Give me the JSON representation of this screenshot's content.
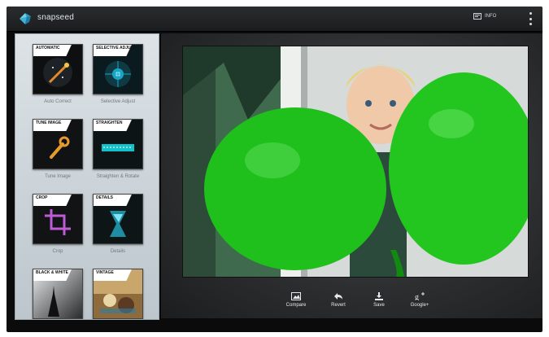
{
  "app": {
    "title": "snapseed",
    "info_label": "INFO"
  },
  "icons": {
    "logo": "snapseed-leaf-icon",
    "info": "info-icon",
    "overflow": "overflow-menu-icon",
    "compare": "compare-icon",
    "revert": "revert-icon",
    "save": "save-icon",
    "share": "google-plus-icon"
  },
  "tools": [
    {
      "tag": "AUTOMATIC",
      "label": "Auto Correct"
    },
    {
      "tag": "SELECTIVE ADJUST",
      "label": "Selective Adjust"
    },
    {
      "tag": "TUNE IMAGE",
      "label": "Tune Image"
    },
    {
      "tag": "STRAIGHTEN",
      "label": "Straighten & Rotate"
    },
    {
      "tag": "CROP",
      "label": "Crop"
    },
    {
      "tag": "DETAILS",
      "label": "Details"
    },
    {
      "tag": "BLACK & WHITE",
      "label": ""
    },
    {
      "tag": "VINTAGE",
      "label": ""
    }
  ],
  "actions": [
    {
      "label": "Compare"
    },
    {
      "label": "Revert"
    },
    {
      "label": "Save"
    },
    {
      "label": "Google+"
    }
  ],
  "colors": {
    "balloon": "#1fbf1c",
    "accent": "#33b5e5",
    "sidebar": "#d3dadf"
  }
}
